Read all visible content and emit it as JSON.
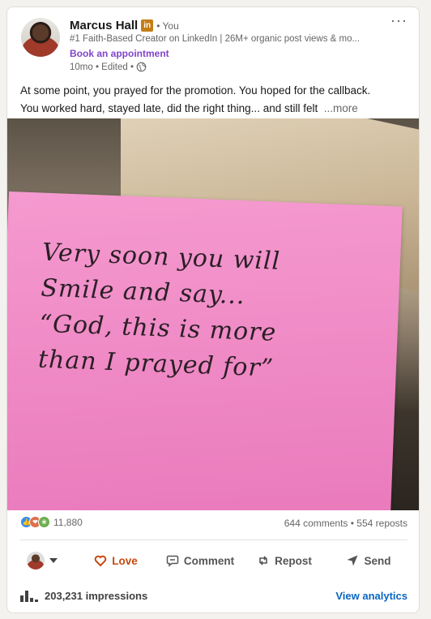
{
  "author": {
    "name": "Marcus Hall",
    "badge": "in",
    "you_label": "• You",
    "headline": "#1 Faith-Based Creator on LinkedIn | 26M+ organic post views & mo...",
    "cta": "Book an appointment",
    "meta": "10mo • Edited •"
  },
  "menu_label": "···",
  "post": {
    "line1": "At some point, you prayed for the promotion. You hoped for the callback.",
    "line2": "You worked hard, stayed late, did the right thing... and still felt",
    "see_more": "...more"
  },
  "image_text": {
    "line1": "Very soon you will",
    "line2": "Smile and say...",
    "line3": "“God, this is more",
    "line4": "than I prayed for”"
  },
  "social": {
    "reaction_count": "11,880",
    "comments_reposts": "644 comments • 554 reposts",
    "reaction_icons": [
      "like-icon",
      "love-icon",
      "support-icon"
    ]
  },
  "actions": {
    "love": "Love",
    "comment": "Comment",
    "repost": "Repost",
    "send": "Send"
  },
  "footer": {
    "impressions": "203,231 impressions",
    "analytics": "View analytics"
  },
  "colors": {
    "brand_blue": "#0a66c2",
    "love_orange": "#c6490f",
    "book_purple": "#8344cc",
    "sticky_pink": "#ee86c3",
    "linkedin_gold": "#c37d16"
  }
}
